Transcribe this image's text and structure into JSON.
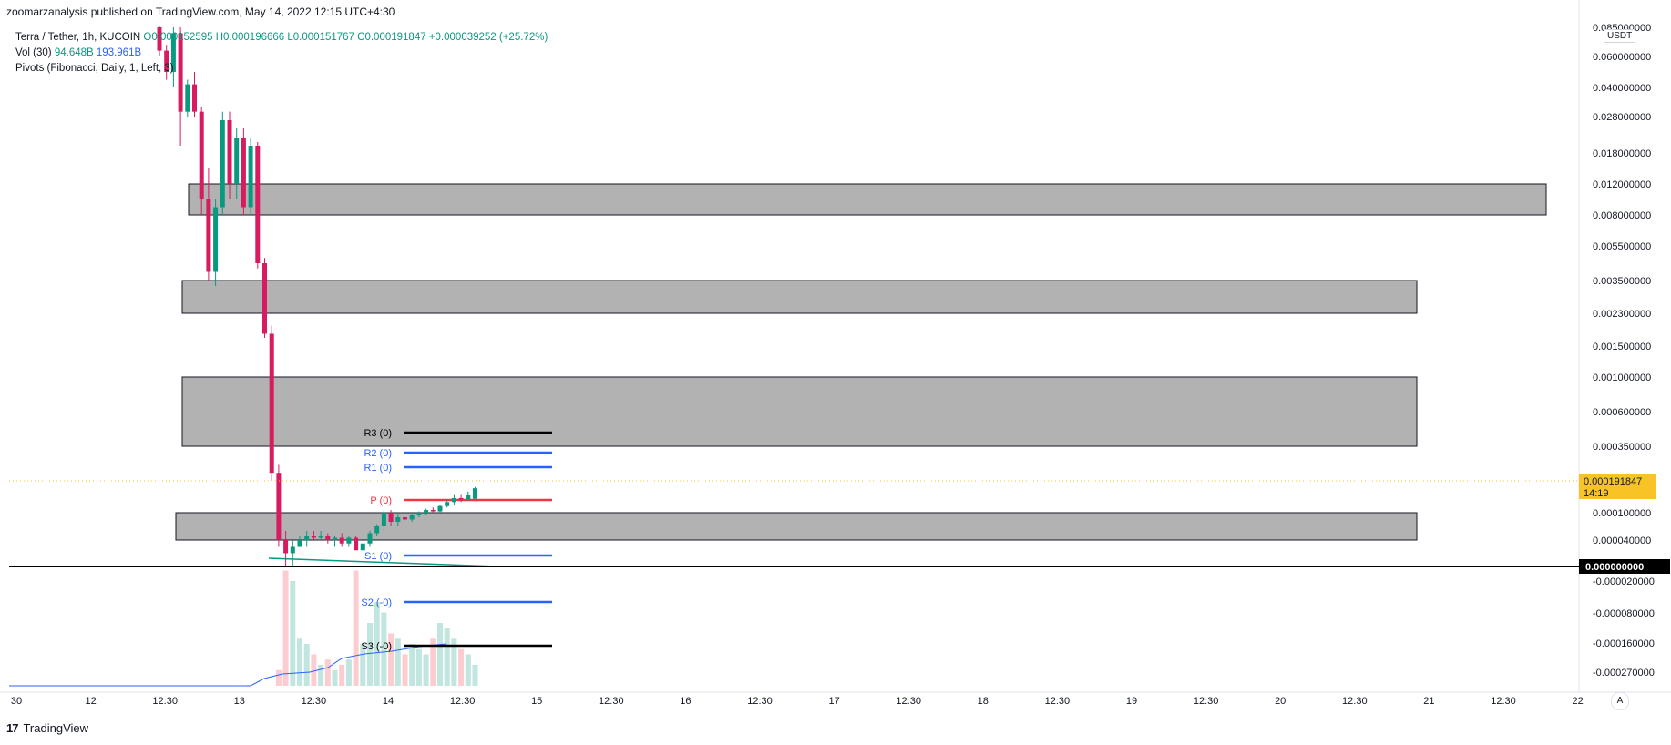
{
  "header": {
    "published_by": "zoomarzanalysis published on TradingView.com, May 14, 2022 12:15 UTC+4:30"
  },
  "legend": {
    "symbol": "Terra / Tether, 1h, KUCOIN",
    "open": "O0.000152595",
    "high": "H0.000196666",
    "low": "L0.000151767",
    "close": "C0.000191847",
    "change": "+0.000039252 (+25.72%)",
    "volume_label": "Vol (30)",
    "volume_value": "94.648B",
    "volume_ma": "193.961B",
    "pivots": "Pivots (Fibonacci, Daily, 1, Left, 3)"
  },
  "price_axis": {
    "currency_line1": "USDT",
    "currency_line2": "",
    "current_price": "0.000191847",
    "countdown": "14:19",
    "zero_label": "0.000000000"
  },
  "footer": {
    "logo": "17",
    "brand": "TradingView",
    "auto_button": "A"
  },
  "colors": {
    "up": "#089981",
    "down": "#f23645",
    "down_body": "#d81b60",
    "zone_fill": "#b2b2b2",
    "zone_stroke": "#131722",
    "resistance_line": "#000000",
    "r1_line": "#2962ff",
    "pivot_line": "#f23645",
    "volume_ma_line": "#2962ff",
    "price_tag": "#f7c325"
  },
  "chart_data": {
    "type": "candlestick",
    "symbol": "Terra / Tether",
    "interval": "1h",
    "exchange": "KUCOIN",
    "y_scale": "nonlinear",
    "y_tick_labels": [
      "0.085000000",
      "0.060000000",
      "0.040000000",
      "0.028000000",
      "0.018000000",
      "0.012000000",
      "0.008000000",
      "0.005500000",
      "0.003500000",
      "0.002300000",
      "0.001500000",
      "0.001000000",
      "0.000600000",
      "0.000350000",
      "0.000100000",
      "0.000040000",
      "-0.000020000",
      "-0.000080000",
      "-0.000160000",
      "-0.000270000"
    ],
    "x_tick_labels": [
      "30",
      "12",
      "12:30",
      "13",
      "12:30",
      "14",
      "12:30",
      "15",
      "12:30",
      "16",
      "12:30",
      "17",
      "12:30",
      "18",
      "12:30",
      "19",
      "12:30",
      "20",
      "12:30",
      "21",
      "12:30",
      "22"
    ],
    "pivots": [
      {
        "label": "R3 (0)",
        "color": "#000000"
      },
      {
        "label": "R2 (0)",
        "color": "#2962ff"
      },
      {
        "label": "R1 (0)",
        "color": "#2962ff"
      },
      {
        "label": "P (0)",
        "color": "#f23645"
      },
      {
        "label": "S1 (0)",
        "color": "#2962ff"
      },
      {
        "label": "S2 (-0)",
        "color": "#2962ff"
      },
      {
        "label": "S3 (-0)",
        "color": "#000000"
      }
    ],
    "zones": [
      {
        "from_price": 0.008,
        "to_price": 0.012
      },
      {
        "from_price": 0.0023,
        "to_price": 0.0035
      },
      {
        "from_price": 0.00035,
        "to_price": 0.001
      },
      {
        "from_price": 4e-05,
        "to_price": 0.0001
      }
    ],
    "candles": [
      {
        "o": 0.085,
        "h": 0.09,
        "l": 0.06,
        "c": 0.065
      },
      {
        "o": 0.065,
        "h": 0.07,
        "l": 0.045,
        "c": 0.05
      },
      {
        "o": 0.05,
        "h": 0.085,
        "l": 0.04,
        "c": 0.08
      },
      {
        "o": 0.08,
        "h": 0.085,
        "l": 0.02,
        "c": 0.03
      },
      {
        "o": 0.03,
        "h": 0.045,
        "l": 0.028,
        "c": 0.042
      },
      {
        "o": 0.042,
        "h": 0.05,
        "l": 0.028,
        "c": 0.03
      },
      {
        "o": 0.03,
        "h": 0.032,
        "l": 0.008,
        "c": 0.01
      },
      {
        "o": 0.01,
        "h": 0.015,
        "l": 0.0035,
        "c": 0.004
      },
      {
        "o": 0.004,
        "h": 0.01,
        "l": 0.0033,
        "c": 0.009
      },
      {
        "o": 0.009,
        "h": 0.03,
        "l": 0.008,
        "c": 0.027
      },
      {
        "o": 0.027,
        "h": 0.03,
        "l": 0.01,
        "c": 0.012
      },
      {
        "o": 0.012,
        "h": 0.025,
        "l": 0.01,
        "c": 0.022
      },
      {
        "o": 0.022,
        "h": 0.025,
        "l": 0.008,
        "c": 0.009
      },
      {
        "o": 0.009,
        "h": 0.022,
        "l": 0.008,
        "c": 0.02
      },
      {
        "o": 0.02,
        "h": 0.021,
        "l": 0.0042,
        "c": 0.0045
      },
      {
        "o": 0.0045,
        "h": 0.0048,
        "l": 0.0017,
        "c": 0.0018
      },
      {
        "o": 0.0018,
        "h": 0.002,
        "l": 0.00022,
        "c": 0.00025
      },
      {
        "o": 0.00025,
        "h": 0.00028,
        "l": 3e-05,
        "c": 4e-05
      },
      {
        "o": 4e-05,
        "h": 6e-05,
        "l": 0.0,
        "c": 1e-05
      },
      {
        "o": 1e-05,
        "h": 4e-05,
        "l": 0.0,
        "c": 3e-05
      },
      {
        "o": 3e-05,
        "h": 5e-05,
        "l": 2e-05,
        "c": 4e-05
      },
      {
        "o": 4e-05,
        "h": 6e-05,
        "l": 3e-05,
        "c": 5e-05
      },
      {
        "o": 5e-05,
        "h": 6e-05,
        "l": 4e-05,
        "c": 4.5e-05
      },
      {
        "o": 4.5e-05,
        "h": 6e-05,
        "l": 4e-05,
        "c": 5e-05
      },
      {
        "o": 5e-05,
        "h": 5.5e-05,
        "l": 3.5e-05,
        "c": 4e-05
      },
      {
        "o": 4e-05,
        "h": 5e-05,
        "l": 3e-05,
        "c": 4.5e-05
      },
      {
        "o": 4.5e-05,
        "h": 5.5e-05,
        "l": 3e-05,
        "c": 3.5e-05
      },
      {
        "o": 3.5e-05,
        "h": 5e-05,
        "l": 3e-05,
        "c": 4.5e-05
      },
      {
        "o": 4.5e-05,
        "h": 5e-05,
        "l": 2e-05,
        "c": 2.5e-05
      },
      {
        "o": 2.5e-05,
        "h": 4e-05,
        "l": 2e-05,
        "c": 3.5e-05
      },
      {
        "o": 3.5e-05,
        "h": 6e-05,
        "l": 3e-05,
        "c": 5.5e-05
      },
      {
        "o": 5.5e-05,
        "h": 7.5e-05,
        "l": 5e-05,
        "c": 7e-05
      },
      {
        "o": 7e-05,
        "h": 0.00011,
        "l": 6e-05,
        "c": 0.0001
      },
      {
        "o": 0.0001,
        "h": 0.00011,
        "l": 7e-05,
        "c": 8e-05
      },
      {
        "o": 8e-05,
        "h": 0.0001,
        "l": 7e-05,
        "c": 9e-05
      },
      {
        "o": 9e-05,
        "h": 0.00011,
        "l": 8e-05,
        "c": 8.5e-05
      },
      {
        "o": 8.5e-05,
        "h": 0.0001,
        "l": 8e-05,
        "c": 9.5e-05
      },
      {
        "o": 9.5e-05,
        "h": 0.000105,
        "l": 9e-05,
        "c": 0.0001
      },
      {
        "o": 0.0001,
        "h": 0.000115,
        "l": 9.5e-05,
        "c": 0.00011
      },
      {
        "o": 0.00011,
        "h": 0.00012,
        "l": 0.0001,
        "c": 0.000105
      },
      {
        "o": 0.000105,
        "h": 0.00013,
        "l": 0.0001,
        "c": 0.000125
      },
      {
        "o": 0.000125,
        "h": 0.00015,
        "l": 0.00012,
        "c": 0.00014
      },
      {
        "o": 0.00014,
        "h": 0.00017,
        "l": 0.00013,
        "c": 0.000155
      },
      {
        "o": 0.000155,
        "h": 0.00017,
        "l": 0.00014,
        "c": 0.00015
      },
      {
        "o": 0.00015,
        "h": 0.00018,
        "l": 0.000145,
        "c": 0.000165
      },
      {
        "o": 0.000152595,
        "h": 0.000196666,
        "l": 0.000151767,
        "c": 0.000191847
      }
    ],
    "volume": [
      0,
      0,
      0,
      0,
      0,
      0,
      0,
      0,
      0,
      0,
      0,
      0,
      0,
      0,
      0,
      0,
      0,
      15,
      110,
      100,
      45,
      40,
      30,
      20,
      25,
      15,
      20,
      25,
      110,
      40,
      60,
      80,
      70,
      50,
      45,
      30,
      40,
      35,
      30,
      45,
      60,
      55,
      45,
      35,
      30,
      20
    ]
  }
}
